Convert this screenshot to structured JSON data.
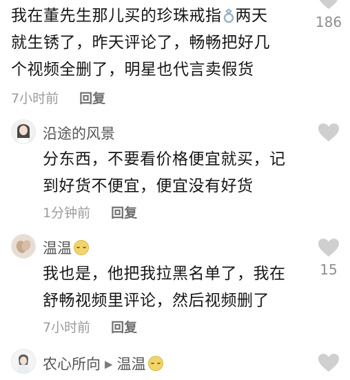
{
  "comments": [
    {
      "lines": [
        "我在董先生那儿买的珍珠戒指",
        "两天",
        "就生锈了，昨天评论了，畅畅把好几",
        "个视频全删了，明星也代言卖假货"
      ],
      "ring_icon": "ring-icon",
      "time": "7小时前",
      "reply": "回复",
      "likes": "186"
    },
    {
      "user": "沿途的风景",
      "lines": [
        "分东西，不要看价格便宜就买，记",
        "到好货不便宜，便宜没有好货"
      ],
      "time": "1分钟前",
      "reply": "回复",
      "likes": ""
    },
    {
      "user": "温温",
      "user_emoji": "relieved-face",
      "lines": [
        "我也是，他把我拉黑名单了，我在",
        "舒畅视频里评论，然后视频删了"
      ],
      "time": "7小时前",
      "reply": "回复",
      "likes": "15"
    },
    {
      "user": "农心所向",
      "reply_to": "温温",
      "reply_to_emoji": "relieved-face"
    }
  ],
  "icons": {
    "like": "heart-icon"
  },
  "colors": {
    "heart": "#cfcfcf",
    "meta": "#9a9a9a",
    "text": "#161616"
  }
}
